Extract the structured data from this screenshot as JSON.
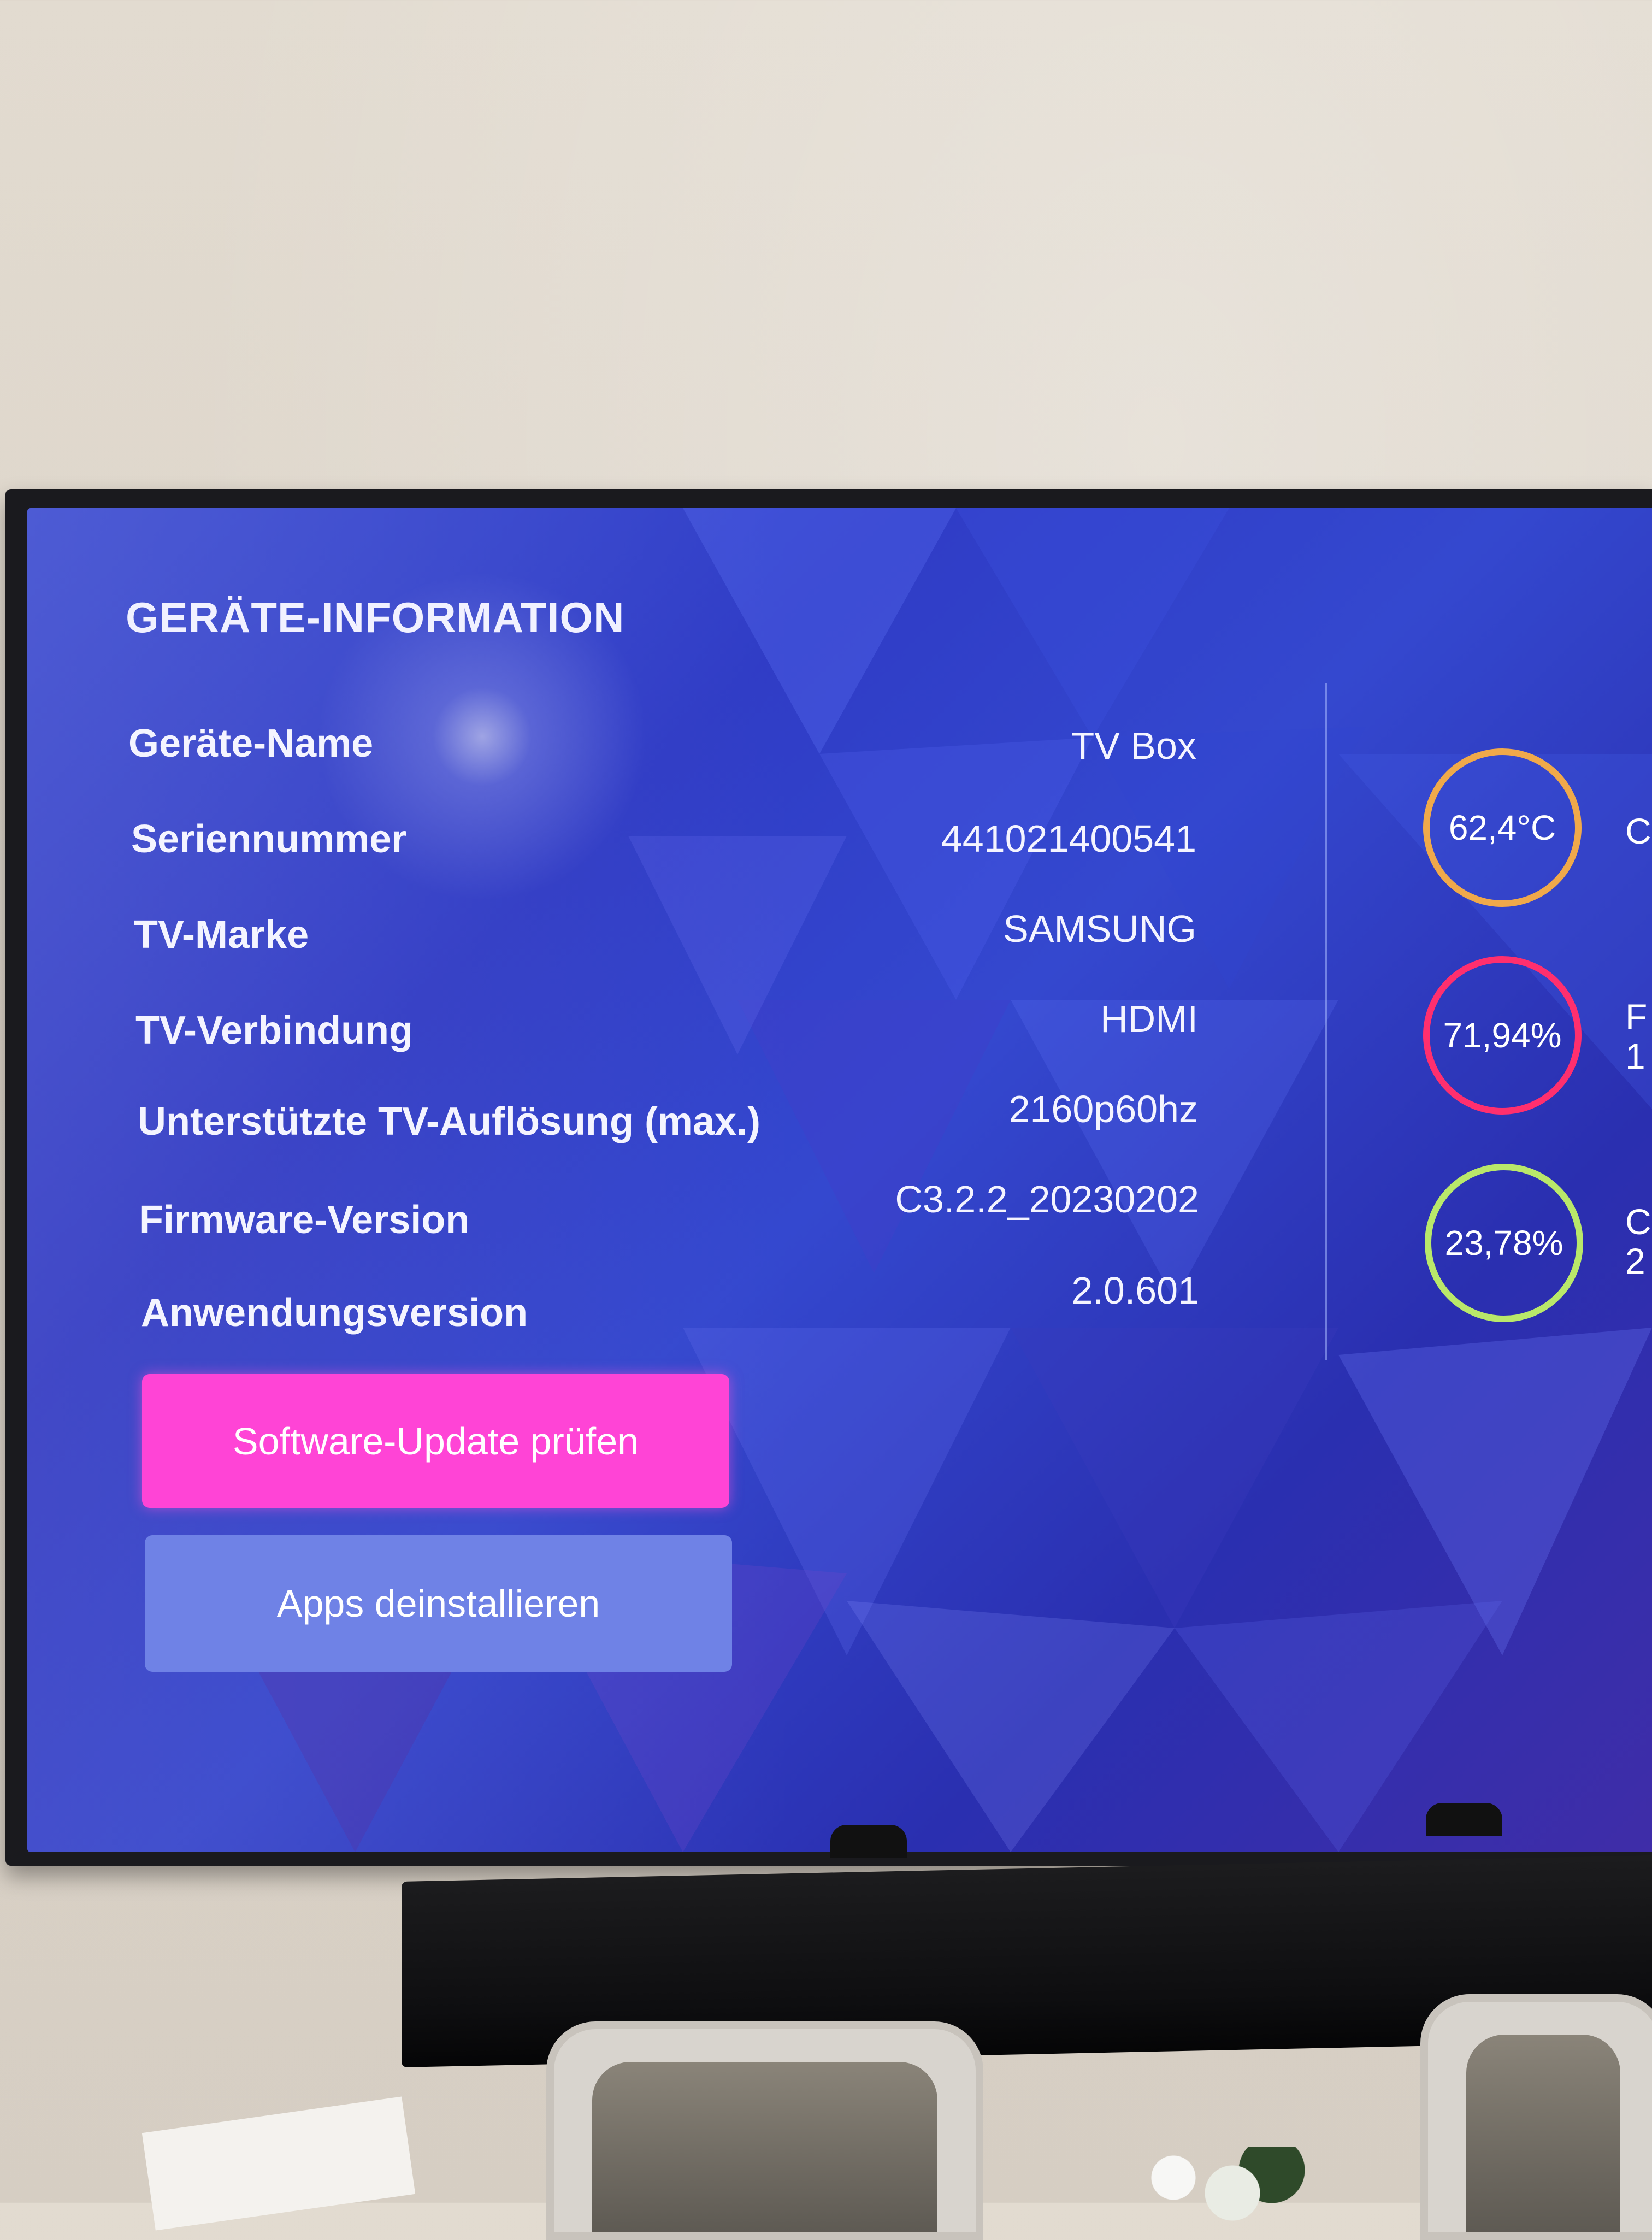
{
  "screen": {
    "title": "GERÄTE-INFORMATION",
    "info_rows": [
      {
        "label": "Geräte-Name",
        "value": "TV Box"
      },
      {
        "label": "Seriennummer",
        "value": "441021400541"
      },
      {
        "label": "TV-Marke",
        "value": "SAMSUNG"
      },
      {
        "label": "TV-Verbindung",
        "value": "HDMI"
      },
      {
        "label": "Unterstützte TV-Auflösung (max.)",
        "value": "2160p60hz"
      },
      {
        "label": "Firmware-Version",
        "value": "C3.2.2_20230202"
      },
      {
        "label": "Anwendungsversion",
        "value": "2.0.601"
      }
    ],
    "gauges": [
      {
        "value": "62,4°C",
        "color": "#f0a94a",
        "edge_label": "C"
      },
      {
        "value": "71,94%",
        "color": "#ff2f6e",
        "edge_label": "F\n1"
      },
      {
        "value": "23,78%",
        "color": "#b9e86a",
        "edge_label": "C\n2"
      }
    ],
    "buttons": {
      "software_update": "Software-Update prüfen",
      "uninstall_apps": "Apps deinstallieren"
    },
    "colors": {
      "update_button": "#ff44d6",
      "apps_button": "#6f82e6",
      "background": "#3448cf"
    }
  }
}
